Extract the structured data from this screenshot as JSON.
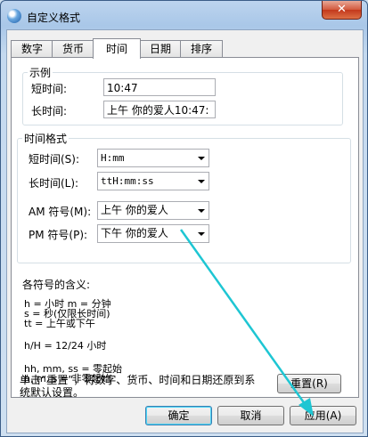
{
  "window": {
    "title": "自定义格式",
    "close_label": "✕"
  },
  "tabs": [
    "数字",
    "货币",
    "时间",
    "日期",
    "排序"
  ],
  "active_tab": "时间",
  "example": {
    "title": "示例",
    "short_label": "短时间:",
    "short_value": "10:47",
    "long_label": "长时间:",
    "long_value": "上午  你的爱人10:47:"
  },
  "format": {
    "title": "时间格式",
    "short_label": "短时间(S):",
    "short_value": "H:mm",
    "long_label": "长时间(L):",
    "long_value": "ttH:mm:ss",
    "am_label": "AM 符号(M):",
    "am_value": "上午 你的爱人",
    "pm_label": "PM 符号(P):",
    "pm_value": "下午 你的爱人"
  },
  "meaning": {
    "title": "各符号的含义:",
    "line1": "h = 小时    m = 分钟",
    "line2": "s = 秒(仅限长时间)",
    "line3": "tt = 上午或下午",
    "line4": "h/H = 12/24 小时",
    "line5": "hh, mm, ss = 零起始",
    "line6": "h, m, s = 非零起始"
  },
  "reset": {
    "text_line1": "单击“重置”，将数字、货币、时间和日期还原到系",
    "text_line2": "统默认设置。",
    "button": "重置(R)"
  },
  "buttons": {
    "ok": "确定",
    "cancel": "取消",
    "apply": "应用(A)"
  },
  "colors": {
    "annotation_arrow": "#1ec6d3"
  }
}
